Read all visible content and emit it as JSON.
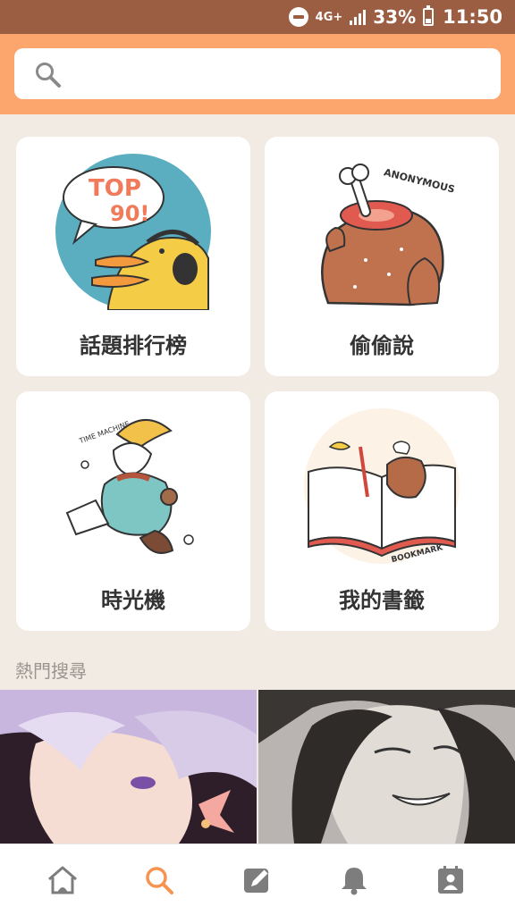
{
  "status_bar": {
    "network": "4G+",
    "battery": "33%",
    "time": "11:50"
  },
  "search": {
    "placeholder": "",
    "value": ""
  },
  "cards": [
    {
      "label": "話題排行榜",
      "badge_line1": "TOP",
      "badge_line2": "90!"
    },
    {
      "label": "偷偷說",
      "sticker": "ANONYMOUS"
    },
    {
      "label": "時光機",
      "sticker": "TIME MACHINE"
    },
    {
      "label": "我的書籤",
      "sticker": "BOOKMARK"
    }
  ],
  "hot_search": {
    "title": "熱門搜尋"
  },
  "bottom_nav": [
    {
      "icon": "home-icon"
    },
    {
      "icon": "search-icon",
      "active": true
    },
    {
      "icon": "edit-icon"
    },
    {
      "icon": "bell-icon"
    },
    {
      "icon": "profile-icon"
    }
  ],
  "colors": {
    "status_bar": "#9b5e43",
    "header": "#fca56d",
    "background": "#f2ebe3",
    "nav_active": "#f5934f",
    "nav_inactive": "#7d7d7d"
  }
}
